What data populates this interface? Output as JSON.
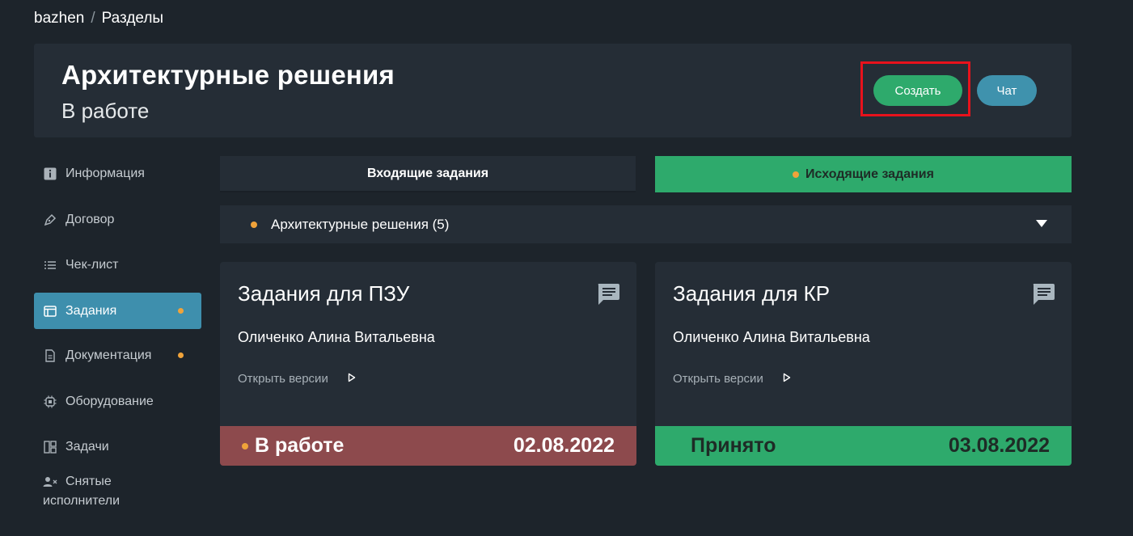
{
  "breadcrumb": {
    "root": "bazhen",
    "separator": "/",
    "current": "Разделы"
  },
  "header": {
    "title": "Архитектурные решения",
    "subtitle": "В работе",
    "create_label": "Создать",
    "chat_label": "Чат"
  },
  "sidebar": {
    "items": [
      {
        "label": "Информация",
        "icon": "info-icon"
      },
      {
        "label": "Договор",
        "icon": "pen-icon"
      },
      {
        "label": "Чек-лист",
        "icon": "checklist-icon"
      },
      {
        "label": "Задания",
        "icon": "tasks-icon",
        "active": true,
        "dot": true
      },
      {
        "label": "Документация",
        "icon": "document-icon",
        "dot": true
      },
      {
        "label": "Оборудование",
        "icon": "chip-icon"
      },
      {
        "label": "Задачи",
        "icon": "dashboard-icon"
      },
      {
        "label_line1": "Снятые",
        "label_line2": "исполнители",
        "icon": "user-remove-icon"
      }
    ]
  },
  "tabs": {
    "incoming": "Входящие задания",
    "outgoing": "Исходящие задания"
  },
  "section": {
    "label": "Архитектурные решения (5)"
  },
  "cards": [
    {
      "title": "Задания для ПЗУ",
      "person": "Оличенко Алина Витальевна",
      "link": "Открыть версии",
      "status": "В работе",
      "date": "02.08.2022",
      "status_color": "#8d4a4d"
    },
    {
      "title": "Задания для КР",
      "person": "Оличенко Алина Витальевна",
      "link": "Открыть версии",
      "status": "Принято",
      "date": "03.08.2022",
      "status_color": "#2eaa6c"
    }
  ],
  "colors": {
    "accent_green": "#2eaa6c",
    "accent_blue": "#3f92ad",
    "dot_orange": "#f0a33a",
    "highlight_red": "#e8121c"
  }
}
